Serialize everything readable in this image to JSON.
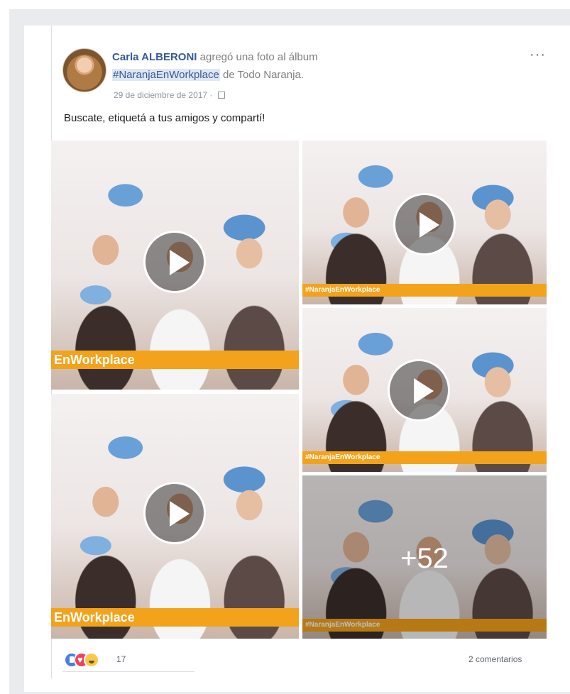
{
  "post": {
    "author": "Carla ALBERONI",
    "action_text": " agregó una foto al álbum",
    "album": "#NaranjaEnWorkplace",
    "album_suffix": " de Todo Naranja.",
    "date": "29 de diciembre de 2017 · ",
    "more_menu": "···",
    "text": "Buscate, etiquetá a tus amigos y compartí!"
  },
  "media": {
    "tiles": [
      {
        "banner": "EnWorkplace"
      },
      {
        "banner": "#NaranjaEnWorkplace"
      },
      {
        "banner": "#NaranjaEnWorkplace"
      },
      {
        "banner": "EnWorkplace"
      },
      {
        "banner": "#NaranjaEnWorkplace",
        "more_count": "+52"
      }
    ]
  },
  "footer": {
    "reaction_icons": [
      "like-icon",
      "love-icon",
      "haha-icon"
    ],
    "reaction_count": "17",
    "comments": "2 comentarios"
  },
  "colors": {
    "link": "#385898",
    "banner": "#f3a21b",
    "like": "#4a7de2",
    "love": "#e9445a",
    "haha": "#f7c94b"
  }
}
